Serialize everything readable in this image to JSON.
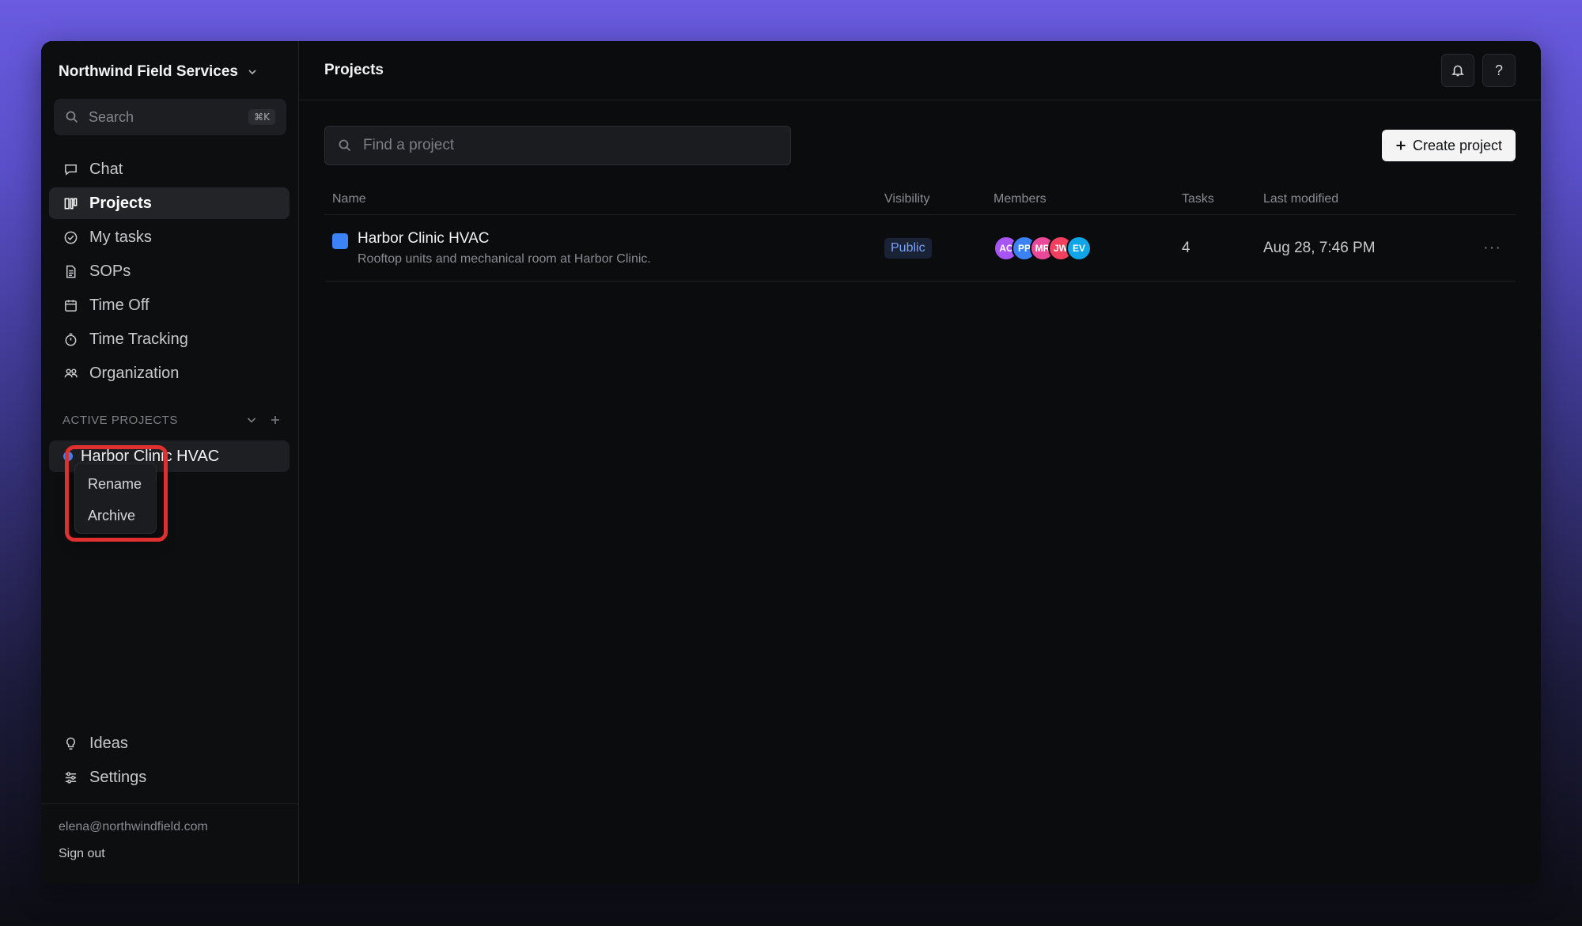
{
  "sidebar": {
    "workspace": "Northwind Field Services",
    "search_label": "Search",
    "search_shortcut": "⌘K",
    "nav": [
      {
        "label": "Chat",
        "icon": "chat-icon"
      },
      {
        "label": "Projects",
        "icon": "projects-icon",
        "active": true
      },
      {
        "label": "My tasks",
        "icon": "check-circle-icon"
      },
      {
        "label": "SOPs",
        "icon": "document-icon"
      },
      {
        "label": "Time Off",
        "icon": "calendar-icon"
      },
      {
        "label": "Time Tracking",
        "icon": "stopwatch-icon"
      },
      {
        "label": "Organization",
        "icon": "people-icon"
      }
    ],
    "active_projects_heading": "ACTIVE PROJECTS",
    "active_project": "Harbor Clinic HVAC",
    "context_menu": [
      "Rename",
      "Archive"
    ],
    "bottom_nav": [
      {
        "label": "Ideas",
        "icon": "lightbulb-icon"
      },
      {
        "label": "Settings",
        "icon": "sliders-icon"
      }
    ],
    "email": "elena@northwindfield.com",
    "sign_out": "Sign out"
  },
  "header": {
    "title": "Projects",
    "help_label": "?"
  },
  "main": {
    "find_placeholder": "Find a project",
    "create_label": "Create project",
    "columns": [
      "Name",
      "Visibility",
      "Members",
      "Tasks",
      "Last modified"
    ],
    "rows": [
      {
        "name": "Harbor Clinic HVAC",
        "description": "Rooftop units and mechanical room at Harbor Clinic.",
        "visibility": "Public",
        "members": [
          {
            "initials": "AC",
            "color": "#a855f7"
          },
          {
            "initials": "PP",
            "color": "#3b82f6"
          },
          {
            "initials": "MR",
            "color": "#ec4899"
          },
          {
            "initials": "JW",
            "color": "#f43f5e"
          },
          {
            "initials": "EV",
            "color": "#0ea5e9"
          }
        ],
        "tasks": "4",
        "last_modified": "Aug 28, 7:46 PM",
        "more": "···"
      }
    ]
  },
  "colors": {
    "accent_blue": "#3b82f6",
    "highlight_red": "#e02f2f"
  }
}
